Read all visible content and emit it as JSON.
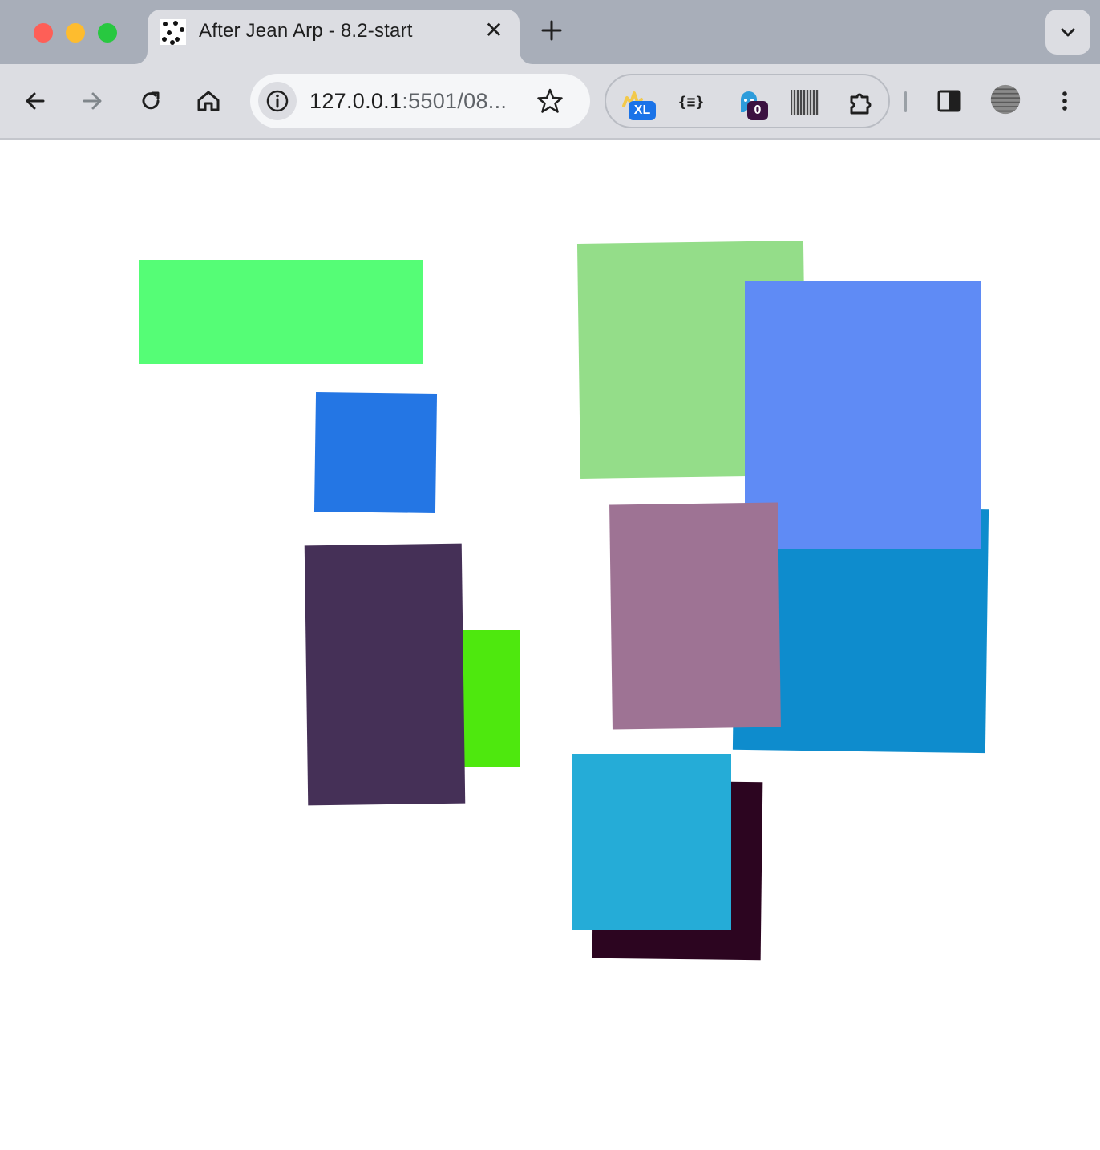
{
  "browser": {
    "tab": {
      "title": "After Jean Arp - 8.2-start",
      "close_glyph": "✕"
    },
    "new_tab_icon": "plus-icon",
    "address_bar": {
      "url_host": "127.0.0.1",
      "url_rest": ":5501/08..."
    },
    "extensions": [
      {
        "name": "xl-extension-icon",
        "badge": "XL",
        "badge_color": "#1a73e8"
      },
      {
        "name": "json-formatter-icon",
        "label": "{≡}"
      },
      {
        "name": "ghostery-icon",
        "badge": "0",
        "badge_color": "#3b1140"
      },
      {
        "name": "noise-extension-icon"
      },
      {
        "name": "puzzle-extensions-icon"
      }
    ]
  },
  "colors": {
    "bright-green": "#55fd76",
    "pale-green": "#94dd89",
    "periwinkle-blue": "#5f8bf5",
    "royal-blue": "#2476e4",
    "dark-purple": "#453057",
    "lime-green": "#4ee80e",
    "mauve": "#9e7394",
    "ocean-blue": "#0e8ccd",
    "sky-blue": "#25acd7",
    "dark-plum": "#2c0520"
  }
}
